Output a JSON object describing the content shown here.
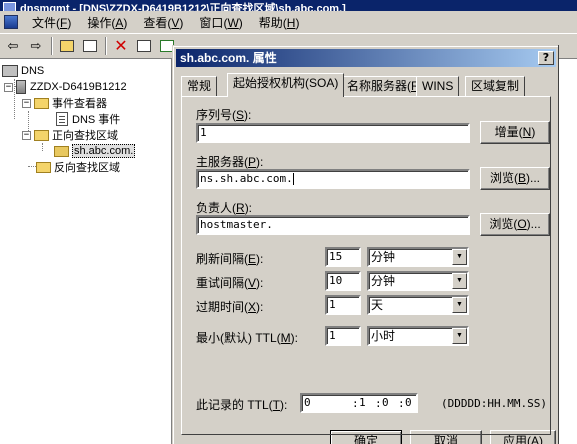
{
  "app": {
    "title": "dnsmgmt - [DNS\\ZZDX-D6419B1212\\正向查找区域\\sh.abc.com.]",
    "menus": [
      {
        "label": "文件",
        "key": "F"
      },
      {
        "label": "操作",
        "key": "A"
      },
      {
        "label": "查看",
        "key": "V"
      },
      {
        "label": "窗口",
        "key": "W"
      },
      {
        "label": "帮助",
        "key": "H"
      }
    ]
  },
  "tree": {
    "root": "DNS",
    "server": "ZZDX-D6419B1212",
    "event_viewer": "事件查看器",
    "dns_events": "DNS 事件",
    "forward_zones": "正向查找区域",
    "zone": "sh.abc.com.",
    "reverse_zones": "反向查找区域"
  },
  "dialog": {
    "title": "sh.abc.com. 属性",
    "help_glyph": "?",
    "close_glyph": "×",
    "tabs": [
      {
        "label": "常规"
      },
      {
        "label": "起始授权机构(SOA)"
      },
      {
        "label": "名称服务器",
        "key": "R"
      },
      {
        "label": "WINS"
      },
      {
        "label": "区域复制"
      }
    ],
    "serial": {
      "label": "序列号",
      "key": "S",
      "value": "1",
      "button": "增量",
      "button_key": "N"
    },
    "primary_server": {
      "label": "主服务器",
      "key": "P",
      "value": "ns.sh.abc.com.",
      "browse": "浏览",
      "browse_key": "B"
    },
    "responsible": {
      "label": "负责人",
      "key": "R",
      "value": "hostmaster.",
      "browse": "浏览",
      "browse_key": "O"
    },
    "refresh": {
      "label": "刷新间隔",
      "key": "E",
      "value": "15",
      "unit": "分钟"
    },
    "retry": {
      "label": "重试间隔",
      "key": "V",
      "value": "10",
      "unit": "分钟"
    },
    "expires": {
      "label": "过期时间",
      "key": "X",
      "value": "1",
      "unit": "天"
    },
    "min_ttl": {
      "label": "最小(默认) TTL",
      "key": "M",
      "value": "1",
      "unit": "小时"
    },
    "record_ttl": {
      "label": "此记录的 TTL",
      "key": "T",
      "d": "0",
      "h": "1",
      "m": "0",
      "s": "0",
      "format": "(DDDDD:HH.MM.SS)"
    },
    "footer": {
      "ok": "确定",
      "cancel": "取消",
      "apply": "应用",
      "apply_key": "A"
    }
  }
}
